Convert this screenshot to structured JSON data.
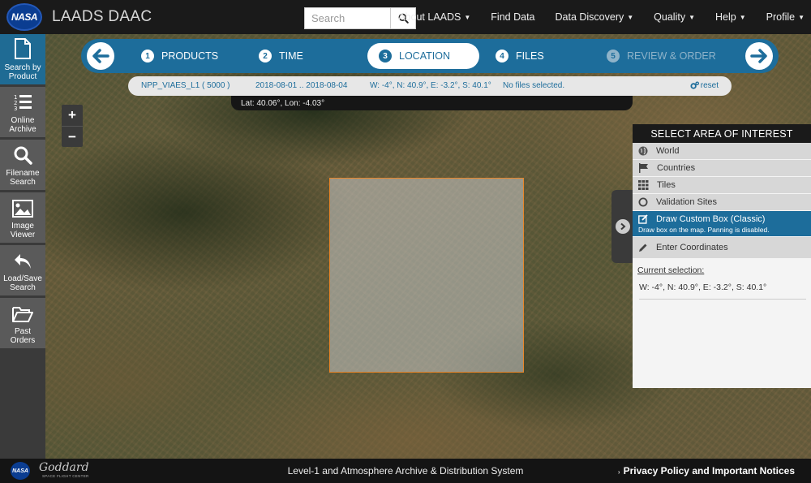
{
  "header": {
    "logo_text": "NASA",
    "app_title": "LAADS DAAC",
    "search_placeholder": "Search",
    "nav": [
      {
        "label": "About LAADS",
        "dropdown": true
      },
      {
        "label": "Find Data",
        "dropdown": false
      },
      {
        "label": "Data Discovery",
        "dropdown": true
      },
      {
        "label": "Quality",
        "dropdown": true
      },
      {
        "label": "Help",
        "dropdown": true
      },
      {
        "label": "Profile",
        "dropdown": true
      }
    ]
  },
  "sidebar": {
    "items": [
      {
        "line1": "Search by",
        "line2": "Product",
        "icon": "file-icon",
        "active": true
      },
      {
        "line1": "Online",
        "line2": "Archive",
        "icon": "list-numbered-icon",
        "active": false
      },
      {
        "line1": "Filename",
        "line2": "Search",
        "icon": "magnifier-icon",
        "active": false
      },
      {
        "line1": "Image",
        "line2": "Viewer",
        "icon": "picture-icon",
        "active": false
      },
      {
        "line1": "Load/Save",
        "line2": "Search",
        "icon": "undo-arrow-icon",
        "active": false
      },
      {
        "line1": "Past",
        "line2": "Orders",
        "icon": "folder-open-icon",
        "active": false
      }
    ]
  },
  "steps": [
    {
      "num": "1",
      "label": "PRODUCTS",
      "state": "done"
    },
    {
      "num": "2",
      "label": "TIME",
      "state": "done"
    },
    {
      "num": "3",
      "label": "LOCATION",
      "state": "active"
    },
    {
      "num": "4",
      "label": "FILES",
      "state": "done"
    },
    {
      "num": "5",
      "label": "REVIEW & ORDER",
      "state": "disabled"
    }
  ],
  "summary": {
    "product": "NPP_VIAES_L1 ( 5000 )",
    "dates": "2018-08-01 .. 2018-08-04",
    "bounds": "W: -4°, N: 40.9°, E: -3.2°, S: 40.1°",
    "files": "No files selected.",
    "reset_label": "reset"
  },
  "coords": "Lat: 40.06°, Lon: -4.03°",
  "zoom": {
    "in": "+",
    "out": "−"
  },
  "panel": {
    "title": "SELECT AREA OF INTEREST",
    "options": [
      {
        "label": "World",
        "icon": "globe-icon"
      },
      {
        "label": "Countries",
        "icon": "flag-icon"
      },
      {
        "label": "Tiles",
        "icon": "grid-icon"
      },
      {
        "label": "Validation Sites",
        "icon": "circle-icon"
      },
      {
        "label": "Draw Custom Box (Classic)",
        "icon": "edit-box-icon",
        "sub": "Draw box on the map. Panning is disabled.",
        "active": true
      },
      {
        "label": "Enter Coordinates",
        "icon": "pencil-icon"
      }
    ],
    "current_label": "Current selection:",
    "current_value": "W: -4°, N: 40.9°, E: -3.2°, S: 40.1°"
  },
  "footer": {
    "nasa_text": "NASA",
    "goddard_text": "Goddard",
    "goddard_sub": "SPACE FLIGHT CENTER",
    "center_text": "Level-1 and Atmosphere Archive & Distribution System",
    "privacy_link": "Privacy Policy and Important Notices"
  },
  "colors": {
    "accent": "#1d6d9b",
    "selection_border": "#e8862a",
    "navbar": "#1a1a1a"
  }
}
